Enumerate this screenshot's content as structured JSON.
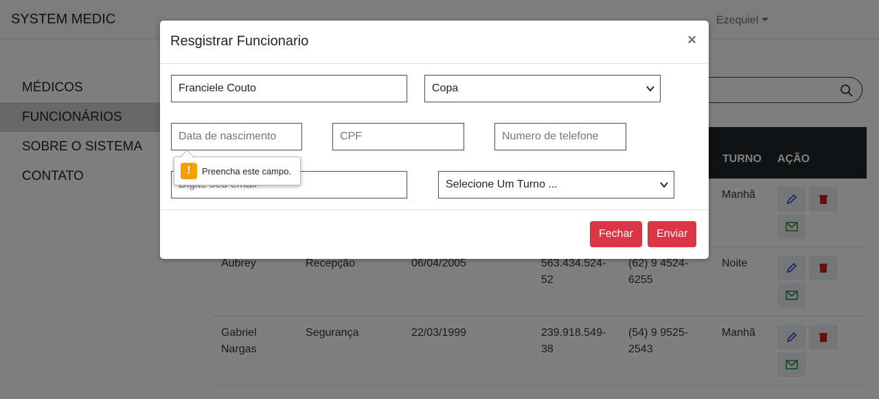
{
  "app": {
    "brand": "SYSTEM MEDIC",
    "user": "Ezequiel"
  },
  "sidebar": {
    "items": [
      {
        "label": "MÉDICOS"
      },
      {
        "label": "FUNCIONÁRIOS"
      },
      {
        "label": "SOBRE O SISTEMA"
      },
      {
        "label": "CONTATO"
      }
    ]
  },
  "table": {
    "headers": [
      "TURNO",
      "AÇÃO"
    ],
    "rows": [
      {
        "nome": "",
        "funcao": "",
        "nascimento": "",
        "cpf": "",
        "telefone": "",
        "turno": "Manhã"
      },
      {
        "nome": "Aubrey",
        "funcao": "Recepção",
        "nascimento": "06/04/2005",
        "cpf": "563.434.524-\n52",
        "telefone": "(62) 9 4524-\n6255",
        "turno": "Noite"
      },
      {
        "nome": "Gabriel\nNargas",
        "funcao": "Segurança",
        "nascimento": "22/03/1999",
        "cpf": "239.918.549-\n38",
        "telefone": "(54) 9 9525-\n2543",
        "turno": "Manhã"
      }
    ]
  },
  "modal": {
    "title": "Resgistrar Funcionario",
    "close": "×",
    "name_value": "Franciele Couto",
    "role_value": "Copa",
    "birth_placeholder": "Data de nascimento",
    "cpf_placeholder": "CPF",
    "phone_placeholder": "Numero de telefone",
    "email_placeholder": "Digite seu email",
    "shift_value": "Selecione Um Turno ...",
    "tooltip": "Preencha este campo.",
    "btn_close": "Fechar",
    "btn_send": "Enviar"
  },
  "colors": {
    "danger": "#dc3545",
    "warning": "#f5a000",
    "edit": "#3b35d1",
    "delete": "#d12020",
    "mail": "#1f8a3b"
  }
}
